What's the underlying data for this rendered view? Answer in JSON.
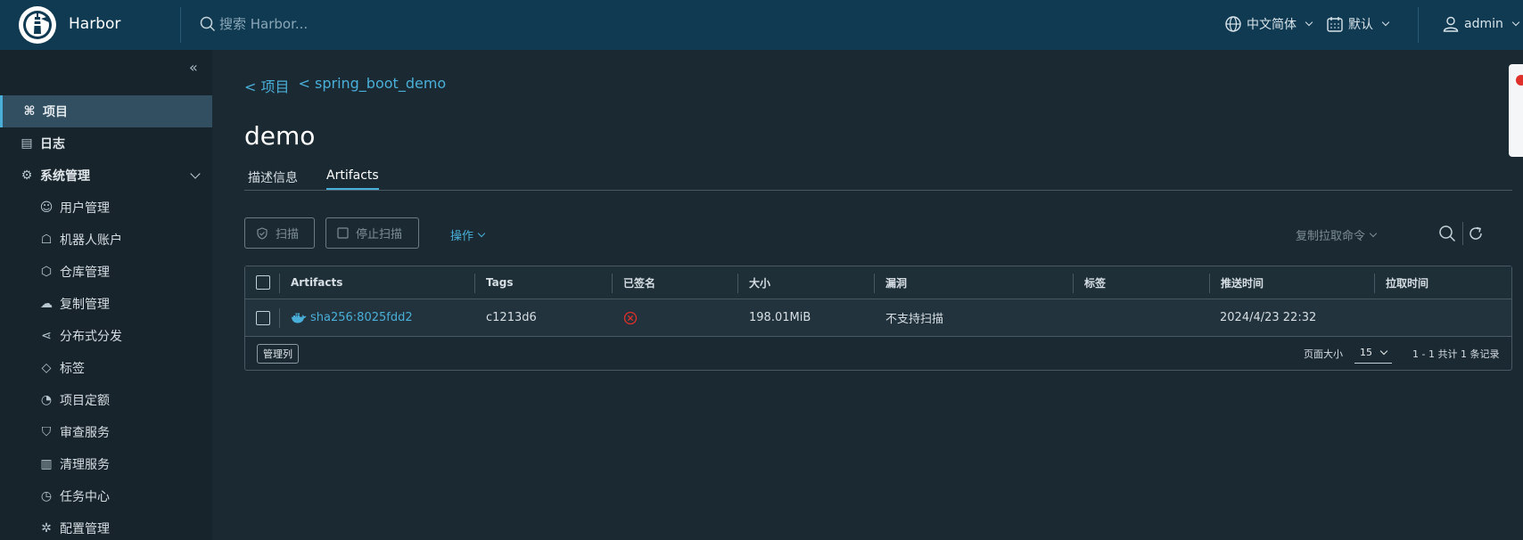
{
  "header": {
    "brand": "Harbor",
    "search_placeholder": "搜索 Harbor...",
    "language": "中文简体",
    "theme": "默认",
    "user": "admin"
  },
  "sidebar": {
    "items": [
      {
        "label": "项目",
        "icon": "project-icon",
        "active": true
      },
      {
        "label": "日志",
        "icon": "log-icon"
      },
      {
        "label": "系统管理",
        "icon": "admin-icon",
        "expanded": true
      },
      {
        "label": "用户管理",
        "icon": "users-icon"
      },
      {
        "label": "机器人账户",
        "icon": "robot-icon"
      },
      {
        "label": "仓库管理",
        "icon": "registry-icon"
      },
      {
        "label": "复制管理",
        "icon": "replication-icon"
      },
      {
        "label": "分布式分发",
        "icon": "share-icon"
      },
      {
        "label": "标签",
        "icon": "tag-icon"
      },
      {
        "label": "项目定额",
        "icon": "quota-icon"
      },
      {
        "label": "审查服务",
        "icon": "shield-icon"
      },
      {
        "label": "清理服务",
        "icon": "trash-icon"
      },
      {
        "label": "任务中心",
        "icon": "dashboard-icon"
      },
      {
        "label": "配置管理",
        "icon": "gear-icon"
      }
    ]
  },
  "breadcrumb": [
    "< 项目",
    "< spring_boot_demo"
  ],
  "page_title": "demo",
  "tabs": [
    {
      "label": "描述信息",
      "active": false
    },
    {
      "label": "Artifacts",
      "active": true
    }
  ],
  "toolbar": {
    "scan": "扫描",
    "stop_scan": "停止扫描",
    "actions": "操作",
    "copy_pull": "复制拉取命令"
  },
  "table": {
    "columns": [
      "Artifacts",
      "Tags",
      "已签名",
      "大小",
      "漏洞",
      "标签",
      "推送时间",
      "拉取时间"
    ],
    "rows": [
      {
        "artifact": "sha256:8025fdd2",
        "tags": "c1213d6",
        "signed": false,
        "size": "198.01MiB",
        "vulnerabilities": "不支持扫描",
        "labels": "",
        "push_time": "2024/4/23 22:32",
        "pull_time": ""
      }
    ],
    "manage_columns": "管理列",
    "page_size_label": "页面大小",
    "page_size": "15",
    "summary": "1 - 1 共计 1 条记录"
  },
  "colors": {
    "header_bg": "#0f3a52",
    "sidebar_bg": "#17242b",
    "main_bg": "#1b2a32",
    "accent": "#49afd9",
    "error": "#e0302a"
  }
}
